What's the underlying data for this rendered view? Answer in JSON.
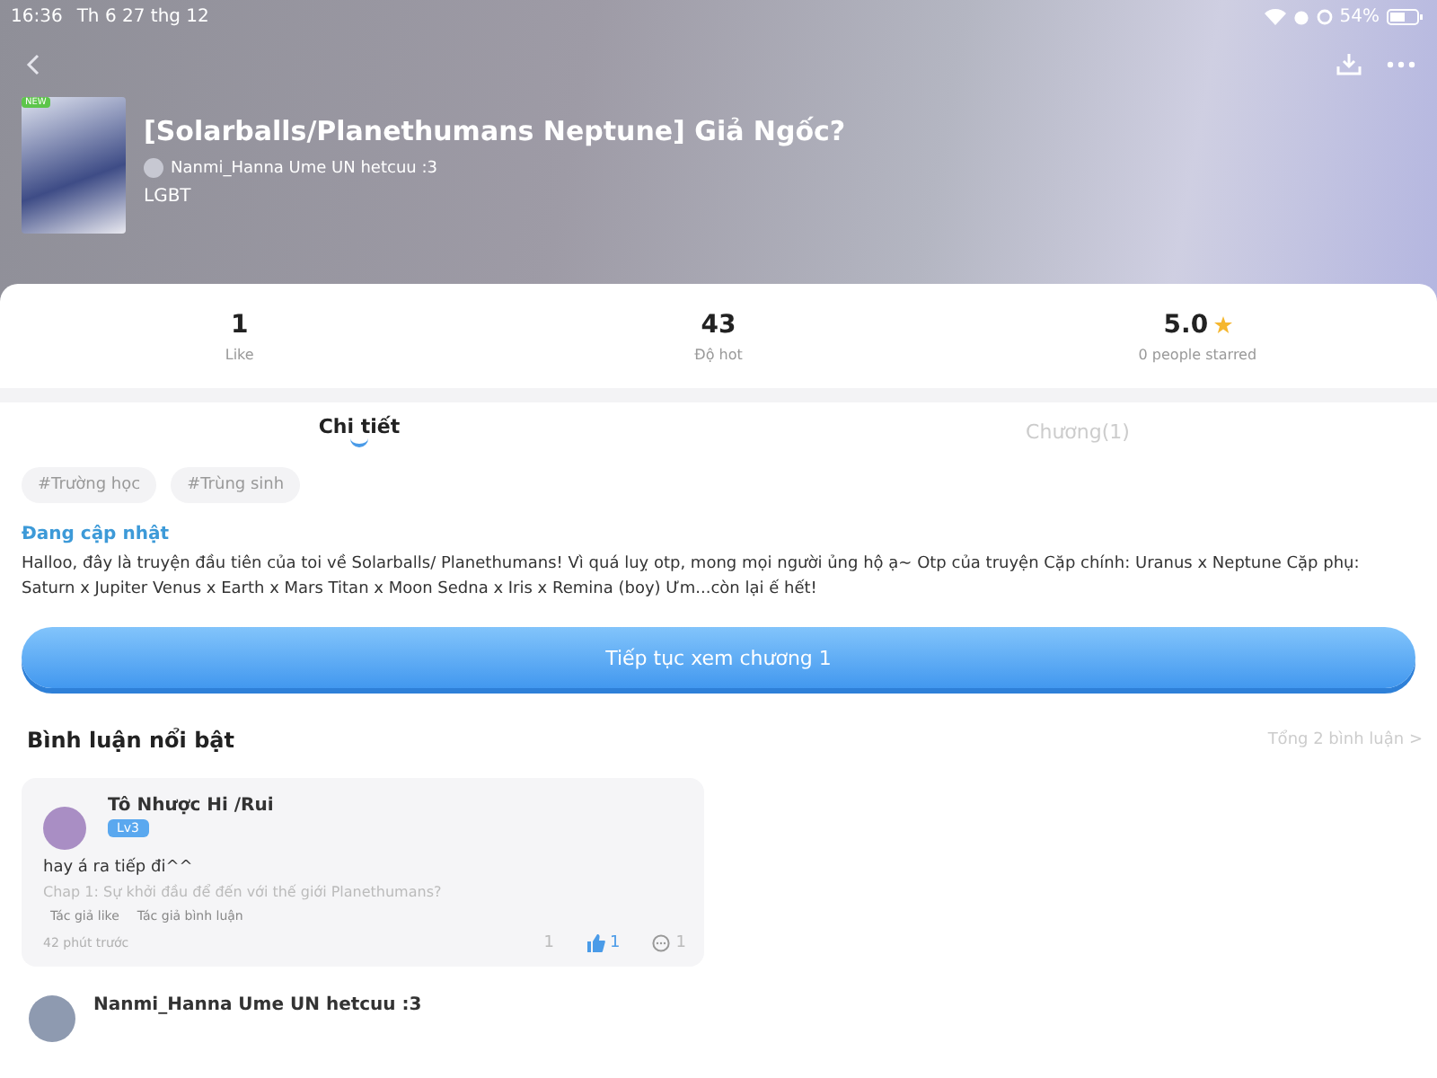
{
  "status_bar": {
    "time": "16:36",
    "date": "Th 6 27 thg 12",
    "battery_text": "54%"
  },
  "header": {
    "cover_badge": "NEW",
    "title": "[Solarballs/Planethumans Neptune] Giả Ngốc?",
    "author": "Nanmi_Hanna Ume UN hetcuu :3",
    "category": "LGBT"
  },
  "stats": [
    {
      "kind": "plain",
      "value": "1",
      "label": "Like"
    },
    {
      "kind": "plain",
      "value": "43",
      "label": "Độ hot"
    },
    {
      "kind": "rating",
      "value": "5.0",
      "label": "0 people starred"
    }
  ],
  "tabs": [
    {
      "label": "Chi tiết",
      "selected": true
    },
    {
      "label": "Chương(1)",
      "selected": false
    }
  ],
  "tags": [
    "#Trường học",
    "#Trùng sinh"
  ],
  "update_status": "Đang cập nhật",
  "description": "Halloo, đây là truyện đầu tiên của toi về Solarballs/ Planethumans! Vì quá luỵ otp, mong mọi người ủng hộ ạ~ Otp của truyện Cặp chính: Uranus x Neptune Cặp phụ: Saturn x Jupiter Venus x Earth x Mars Titan x Moon Sedna x Iris x Remina (boy) Ưm...còn lại ế hết!",
  "continue_button": "Tiếp tục xem chương 1",
  "comments_section": {
    "title": "Bình luận nổi bật",
    "total_link": "Tổng 2 bình luận >"
  },
  "comments": [
    {
      "kind": "card",
      "user": "Tô Nhược Hi /Rui",
      "level": "Lv3",
      "text": "hay á ra tiếp đi^^",
      "chapter": "Chap 1: Sự khởi đầu để đến với thế giới Planethumans?",
      "badges": [
        "Tác giả like",
        "Tác giả bình luận"
      ],
      "time": "42 phút trước",
      "count": "1",
      "likes": "1",
      "replies": "1"
    },
    {
      "kind": "plain",
      "user": "Nanmi_Hanna Ume UN hetcuu :3"
    }
  ]
}
